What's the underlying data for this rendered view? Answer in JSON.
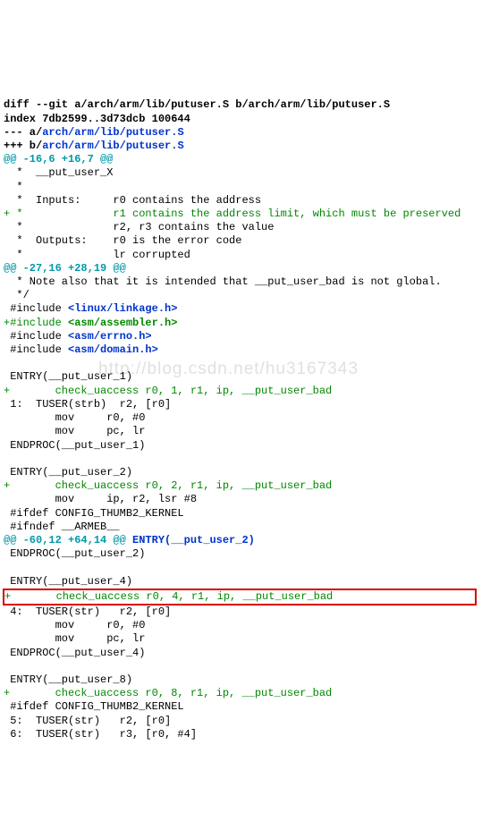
{
  "watermark": "http://blog.csdn.net/hu3167343",
  "header": {
    "diff_line": "diff --git a/arch/arm/lib/putuser.S b/arch/arm/lib/putuser.S",
    "index_line": "index 7db2599..3d73dcb 100644",
    "minus_prefix": "--- a/",
    "minus_path": "arch/arm/lib/putuser.S",
    "plus_prefix": "+++ b/",
    "plus_path": "arch/arm/lib/putuser.S"
  },
  "hunk1": {
    "header": "@@ -16,6 +16,7 @@",
    "l1": "  *  __put_user_X",
    "l2": "  *",
    "l3": "  *  Inputs:     r0 contains the address",
    "l4": "+ *              r1 contains the address limit, which must be preserved",
    "l5": "  *              r2, r3 contains the value",
    "l6": "  *  Outputs:    r0 is the error code",
    "l7": "  *              lr corrupted"
  },
  "hunk2": {
    "header": "@@ -27,16 +28,19 @@",
    "l1": "  * Note also that it is intended that __put_user_bad is not global.",
    "l2": "  */",
    "l3a": " #include ",
    "l3b": "<linux/linkage.h>",
    "l4a": "+#include ",
    "l4b": "<asm/assembler.h>",
    "l5a": " #include ",
    "l5b": "<asm/errno.h>",
    "l6a": " #include ",
    "l6b": "<asm/domain.h>",
    "l7": " ",
    "l8": " ENTRY(__put_user_1)",
    "l9": "+       check_uaccess r0, 1, r1, ip, __put_user_bad",
    "l10": " 1:  TUSER(strb)  r2, [r0]",
    "l11": "        mov     r0, #0",
    "l12": "        mov     pc, lr",
    "l13": " ENDPROC(__put_user_1)",
    "l14": " ",
    "l15": " ENTRY(__put_user_2)",
    "l16": "+       check_uaccess r0, 2, r1, ip, __put_user_bad",
    "l17": "        mov     ip, r2, lsr #8",
    "l18": " #ifdef CONFIG_THUMB2_KERNEL",
    "l19": " #ifndef __ARMEB__"
  },
  "hunk3": {
    "header_a": "@@ -60,12 +64,14 @@",
    "header_b": " ENTRY(__put_user_2)",
    "l1": " ENDPROC(__put_user_2)",
    "l2": " ",
    "l3": " ENTRY(__put_user_4)",
    "l4": "+       check_uaccess r0, 4, r1, ip, __put_user_bad",
    "l5": " 4:  TUSER(str)   r2, [r0]",
    "l6": "        mov     r0, #0",
    "l7": "        mov     pc, lr",
    "l8": " ENDPROC(__put_user_4)",
    "l9": " ",
    "l10": " ENTRY(__put_user_8)",
    "l11": "+       check_uaccess r0, 8, r1, ip, __put_user_bad",
    "l12": " #ifdef CONFIG_THUMB2_KERNEL",
    "l13": " 5:  TUSER(str)   r2, [r0]",
    "l14": " 6:  TUSER(str)   r3, [r0, #4]"
  }
}
